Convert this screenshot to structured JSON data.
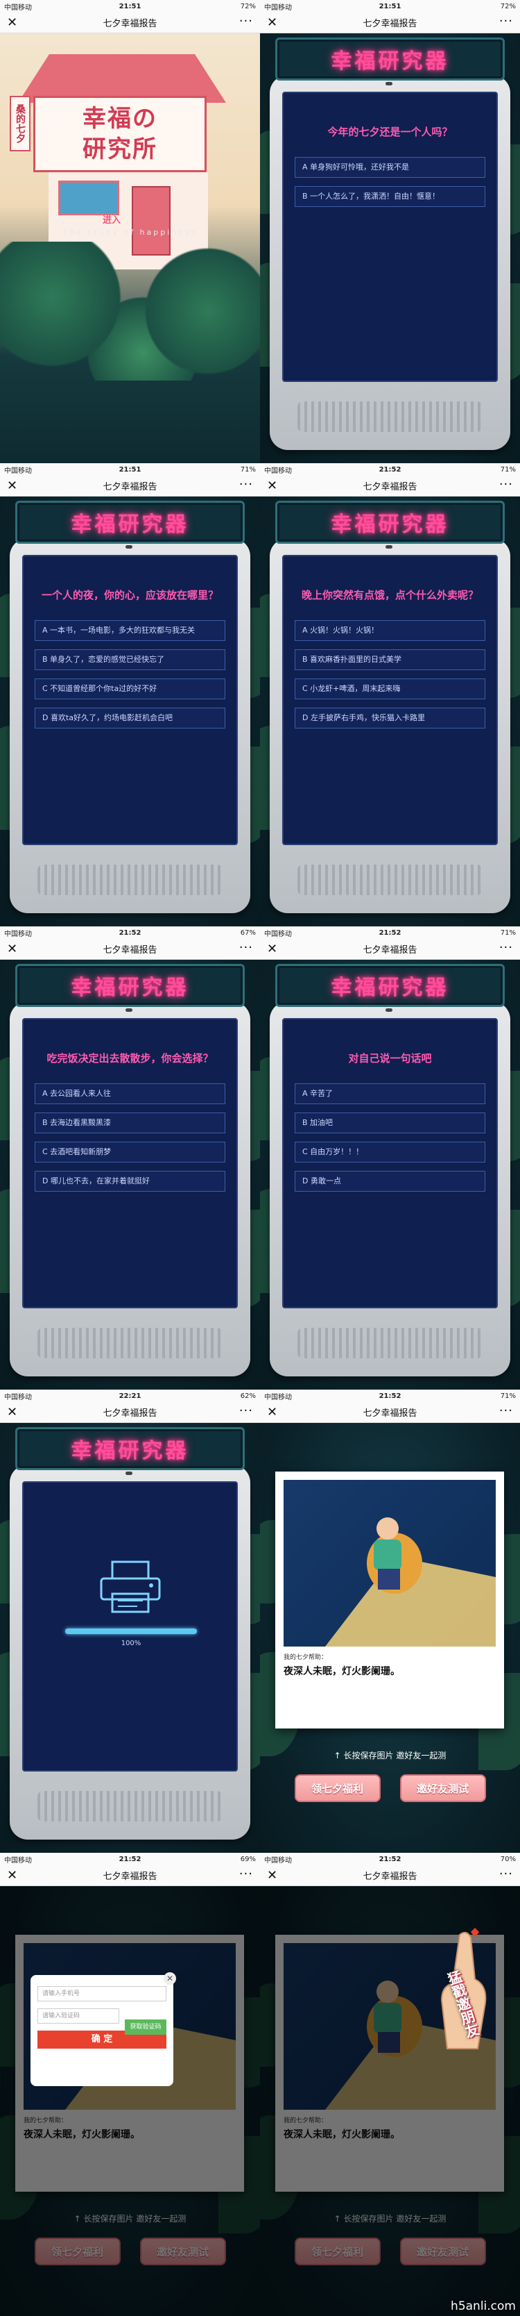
{
  "app_title": "七夕幸福报告",
  "close_icon": "close-icon",
  "more_icon": "more-icon",
  "carrier": "中国移动",
  "screens": [
    {
      "time": "21:51",
      "battery": "72%"
    },
    {
      "time": "21:51",
      "battery": "72%"
    },
    {
      "time": "21:51",
      "battery": "71%"
    },
    {
      "time": "21:52",
      "battery": "71%"
    },
    {
      "time": "21:52",
      "battery": "67%"
    },
    {
      "time": "21:52",
      "battery": "71%"
    },
    {
      "time": "22:21",
      "battery": "62%"
    },
    {
      "time": "21:52",
      "battery": "71%"
    },
    {
      "time": "21:52",
      "battery": "69%"
    },
    {
      "time": "21:52",
      "battery": "70%"
    }
  ],
  "cover": {
    "title_line1": "幸福の",
    "title_line2": "研究所",
    "side_label": "桑的七夕",
    "enter": "进入",
    "tagline": "The study of happiness"
  },
  "sign_text": "幸福研究器",
  "questions": [
    {
      "q": "今年的七夕还是一个人吗？",
      "options": [
        "A 单身狗好可怜哦，还好我不是",
        "B 一个人怎么了，我潇洒！自由！惬意！"
      ]
    },
    {
      "q": "一个人的夜，你的心，应该放在哪里？",
      "options": [
        "A 一本书，一场电影，多大的狂欢都与我无关",
        "B 单身久了，恋爱的感觉已经快忘了",
        "C 不知道曾经那个你ta过的好不好",
        "D 喜欢ta好久了，约场电影赶机会白吧"
      ]
    },
    {
      "q": "晚上你突然有点饿，点个什么外卖呢？",
      "options": [
        "A 火锅！火锅！火锅！",
        "B 喜欢麻香扑面里的日式美学",
        "C 小龙虾+啤酒，周末起来嗨",
        "D 左手披萨右手鸡，快乐猫入卡路里"
      ]
    },
    {
      "q": "吃完饭决定出去散散步，你会选择？",
      "options": [
        "A 去公园看人来人往",
        "B 去海边看黑黢黑漆",
        "C 去酒吧看知新朋梦",
        "D 哪儿也不去，在家并着就挺好"
      ]
    },
    {
      "q": "对自己说一句话吧",
      "options": [
        "A 辛苦了",
        "B 加油吧",
        "C 自由万岁！！！",
        "D 勇敢一点"
      ]
    }
  ],
  "loading": {
    "percent_text": "100%",
    "progress": 1.0
  },
  "result": {
    "caption_small": "我的七夕帮助：",
    "caption_big": "夜深人未眠，灯火影阑珊。",
    "hint": "↑ 长按保存图片 邀好友一起测",
    "btn_gift": "领七夕福利",
    "btn_invite": "邀好友测试"
  },
  "dialog": {
    "phone_placeholder": "请输入手机号",
    "code_placeholder": "请输入验证码",
    "get_code": "获取验证码",
    "confirm": "确 定"
  },
  "invite_hand_text": "猛戳邀朋友",
  "watermark": "h5anli.com"
}
